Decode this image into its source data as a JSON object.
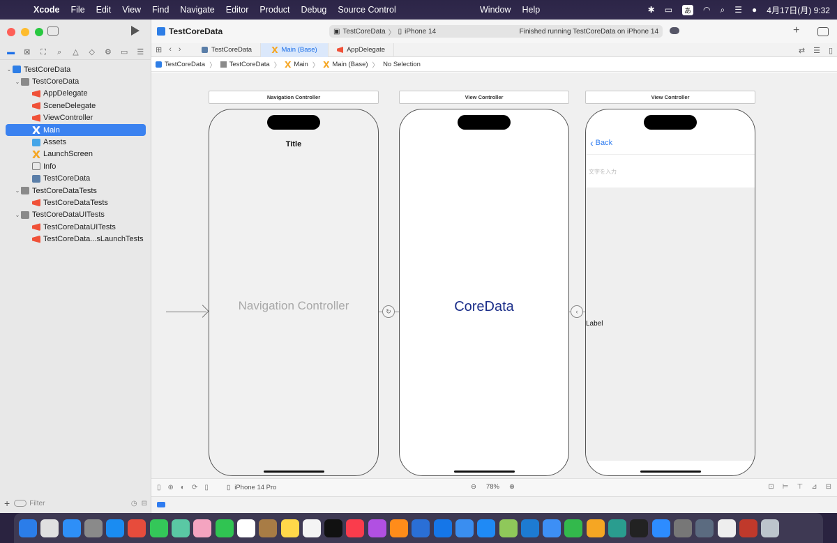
{
  "menubar": {
    "app_name": "Xcode",
    "items": [
      "File",
      "Edit",
      "View",
      "Find",
      "Navigate",
      "Editor",
      "Product",
      "Debug",
      "Source Control"
    ],
    "center_items": [
      "Window",
      "Help"
    ],
    "ime": "あ",
    "clock": "4月17日(月)  9:32"
  },
  "toolbar": {
    "project_title": "TestCoreData",
    "scheme": "TestCoreData",
    "destination": "iPhone 14",
    "status": "Finished running TestCoreData on iPhone 14"
  },
  "navigator": {
    "items": [
      {
        "label": "TestCoreData",
        "icon": "project-icon",
        "level": 0,
        "disclosure": "v"
      },
      {
        "label": "TestCoreData",
        "icon": "folder-icon",
        "level": 1,
        "disclosure": "v"
      },
      {
        "label": "AppDelegate",
        "icon": "swift-file-icon",
        "level": 2
      },
      {
        "label": "SceneDelegate",
        "icon": "swift-file-icon",
        "level": 2
      },
      {
        "label": "ViewController",
        "icon": "swift-file-icon",
        "level": 2
      },
      {
        "label": "Main",
        "icon": "storyboard-icon",
        "level": 2,
        "selected": true
      },
      {
        "label": "Assets",
        "icon": "assets-icon",
        "level": 2
      },
      {
        "label": "LaunchScreen",
        "icon": "storyboard-icon",
        "level": 2
      },
      {
        "label": "Info",
        "icon": "plist-icon",
        "level": 2
      },
      {
        "label": "TestCoreData",
        "icon": "datamodel-icon",
        "level": 2
      },
      {
        "label": "TestCoreDataTests",
        "icon": "folder-icon",
        "level": 1,
        "disclosure": "v"
      },
      {
        "label": "TestCoreDataTests",
        "icon": "swift-file-icon",
        "level": 2
      },
      {
        "label": "TestCoreDataUITests",
        "icon": "folder-icon",
        "level": 1,
        "disclosure": "v"
      },
      {
        "label": "TestCoreDataUITests",
        "icon": "swift-file-icon",
        "level": 2
      },
      {
        "label": "TestCoreData...sLaunchTests",
        "icon": "swift-file-icon",
        "level": 2
      }
    ],
    "filter_placeholder": "Filter"
  },
  "tabs": [
    {
      "label": "TestCoreData",
      "active": false
    },
    {
      "label": "Main (Base)",
      "active": true
    },
    {
      "label": "AppDelegate",
      "active": false
    }
  ],
  "jumpbar": [
    "TestCoreData",
    "TestCoreData",
    "Main",
    "Main (Base)",
    "No Selection"
  ],
  "canvas": {
    "scenes": [
      {
        "title": "Navigation Controller",
        "center_label": "Navigation Controller",
        "nav_title": "Title"
      },
      {
        "title": "View Controller",
        "center_label": "CoreData"
      },
      {
        "title": "View Controller",
        "back_label": "Back",
        "textfield_placeholder": "文字を入力",
        "label": "Label"
      }
    ]
  },
  "bottombar": {
    "device": "iPhone 14 Pro",
    "zoom": "78%"
  },
  "colors": {
    "accent": "#3b82f0",
    "coredata_label": "#1c2f8a",
    "back_button": "#2f7cf0"
  }
}
